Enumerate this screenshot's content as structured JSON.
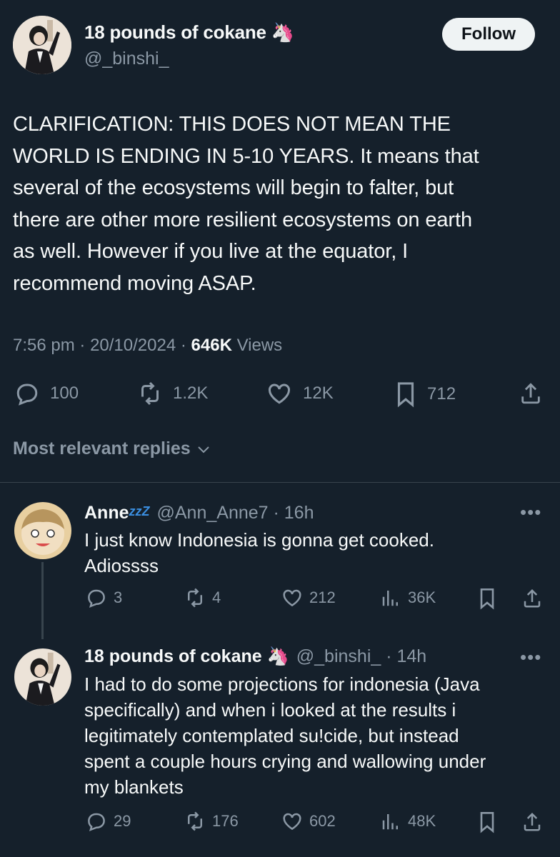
{
  "tweet": {
    "author_name": "18 pounds of cokane",
    "author_emoji": "🦄",
    "author_handle": "@_binshi_",
    "follow_label": "Follow",
    "text": "CLARIFICATION: THIS DOES NOT MEAN THE\nWORLD IS ENDING IN 5-10 YEARS. It means that\nseveral of the ecosystems will begin to falter, but\nthere are other more resilient ecosystems on earth\nas well. However if you live at the equator, I\nrecommend moving ASAP.",
    "time": "7:56 pm",
    "date": "20/10/2024",
    "views_count": "646K",
    "views_label": "Views",
    "replies": "100",
    "reposts": "1.2K",
    "likes": "12K",
    "bookmarks": "712"
  },
  "replies_header": "Most relevant replies",
  "replies": [
    {
      "name": "Anne",
      "name_suffix": "zzZ",
      "handle": "@Ann_Anne7",
      "time": "16h",
      "text": "I just know Indonesia is gonna get cooked.\nAdiossss",
      "replies": "3",
      "reposts": "4",
      "likes": "212",
      "views": "36K"
    },
    {
      "name": "18 pounds of cokane",
      "name_emoji": "🦄",
      "handle": "@_binshi_",
      "time": "14h",
      "text": "I had to do some projections for indonesia (Java\nspecifically) and when i looked at the results i\nlegitimately contemplated su!cide, but instead\nspent a couple hours crying and wallowing under\nmy blankets",
      "replies": "29",
      "reposts": "176",
      "likes": "602",
      "views": "48K"
    }
  ],
  "colors": {
    "background": "#15202b",
    "text": "#f7f9f9",
    "muted": "#8b98a5",
    "divider": "#38444d",
    "follow_bg": "#eff3f4"
  },
  "icons": [
    "reply-icon",
    "repost-icon",
    "like-icon",
    "bookmark-icon",
    "share-icon",
    "views-icon",
    "more-icon",
    "chevron-down-icon",
    "unicorn-emoji"
  ]
}
